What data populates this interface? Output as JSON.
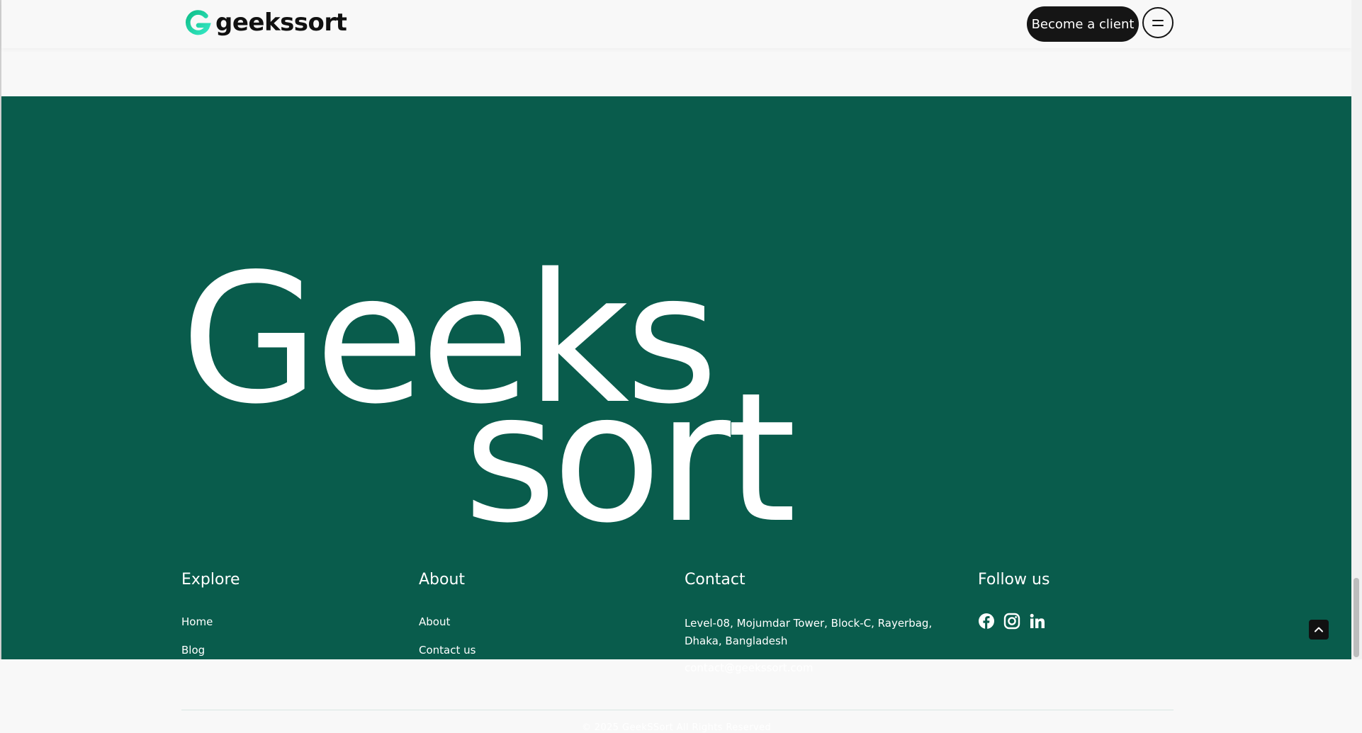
{
  "header": {
    "logo_text": "geekssort",
    "cta_label": "Become a client",
    "menu_icon": "menu-icon"
  },
  "footer": {
    "big_line_1": "Geeks",
    "big_line_2": "sort",
    "explore": {
      "title": "Explore",
      "links": [
        "Home",
        "Blog"
      ]
    },
    "about": {
      "title": "About",
      "links": [
        "About",
        "Contact us"
      ]
    },
    "contact": {
      "title": "Contact",
      "address": "Level-08, Mojumdar Tower, Block-C, Rayerbag, Dhaka, Bangladesh",
      "email": "contact@geekssort.com"
    },
    "follow": {
      "title": "Follow us",
      "icons": [
        "facebook-icon",
        "instagram-icon",
        "linkedin-icon"
      ]
    },
    "copyright": "© 2025 GeekSSort All Rights Reserved"
  },
  "colors": {
    "footer_bg": "#095c4c",
    "header_bg": "#f8f8f8",
    "accent": "#1ed6a5",
    "button_dark": "#151515"
  }
}
